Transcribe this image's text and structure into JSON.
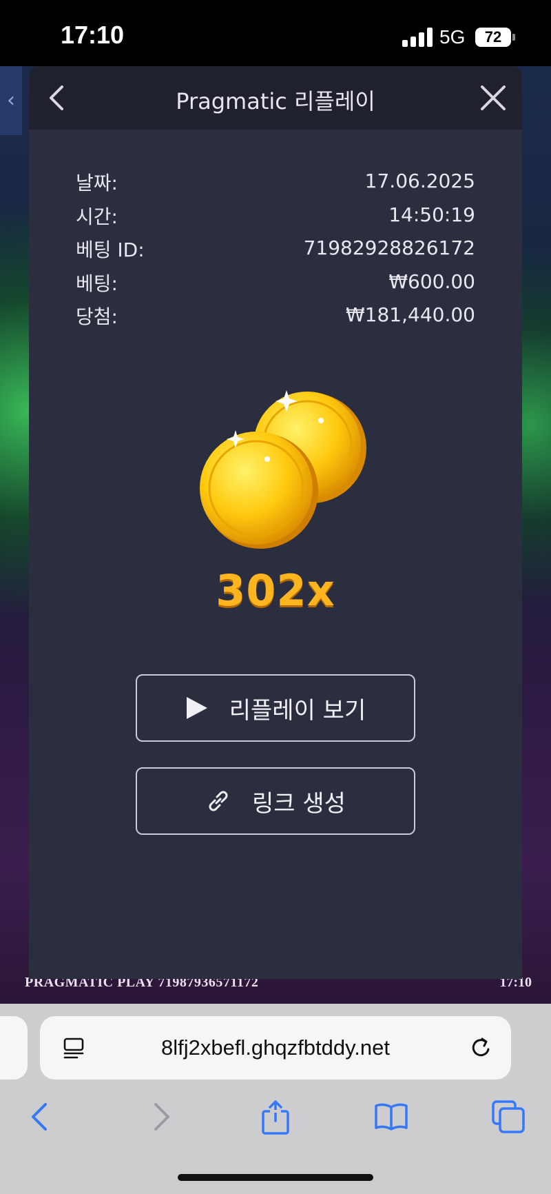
{
  "status_bar": {
    "time": "17:10",
    "network": "5G",
    "battery": "72"
  },
  "game": {
    "footer_left": "PRAGMATIC PLAY  71987936571172",
    "footer_right": "17:10"
  },
  "modal": {
    "title": "Pragmatic 리플레이",
    "rows": [
      {
        "label": "날짜:",
        "value": "17.06.2025"
      },
      {
        "label": "시간:",
        "value": "14:50:19"
      },
      {
        "label": "베팅 ID:",
        "value": "71982928826172"
      },
      {
        "label": "베팅:",
        "value": "₩600.00"
      },
      {
        "label": "당첨:",
        "value": "₩181,440.00"
      }
    ],
    "multiplier": "302x",
    "replay_button": "리플레이 보기",
    "link_button": "링크 생성"
  },
  "browser": {
    "url": "8lfj2xbefl.ghqzfbtddy.net",
    "accent_color": "#3478f6"
  }
}
